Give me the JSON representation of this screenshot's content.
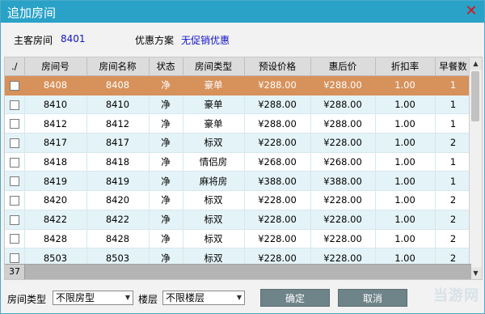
{
  "window": {
    "title": "追加房间"
  },
  "info": {
    "main_room_label": "主客房间",
    "main_room_value": "8401",
    "promo_label": "优惠方案",
    "promo_value": "无促销优惠"
  },
  "table": {
    "columns": [
      "./",
      "房间号",
      "房间名称",
      "状态",
      "房间类型",
      "预设价格",
      "惠后价",
      "折扣率",
      "早餐数"
    ],
    "rows": [
      {
        "room": "8408",
        "name": "8408",
        "status": "净",
        "type": "豪单",
        "price": "¥288.00",
        "after": "¥288.00",
        "rate": "1.00",
        "breakfast": "1",
        "selected": true
      },
      {
        "room": "8410",
        "name": "8410",
        "status": "净",
        "type": "豪单",
        "price": "¥288.00",
        "after": "¥288.00",
        "rate": "1.00",
        "breakfast": "1"
      },
      {
        "room": "8412",
        "name": "8412",
        "status": "净",
        "type": "豪单",
        "price": "¥288.00",
        "after": "¥288.00",
        "rate": "1.00",
        "breakfast": "1"
      },
      {
        "room": "8417",
        "name": "8417",
        "status": "净",
        "type": "标双",
        "price": "¥228.00",
        "after": "¥228.00",
        "rate": "1.00",
        "breakfast": "2"
      },
      {
        "room": "8418",
        "name": "8418",
        "status": "净",
        "type": "情侣房",
        "price": "¥268.00",
        "after": "¥268.00",
        "rate": "1.00",
        "breakfast": "1"
      },
      {
        "room": "8419",
        "name": "8419",
        "status": "净",
        "type": "麻将房",
        "price": "¥388.00",
        "after": "¥388.00",
        "rate": "1.00",
        "breakfast": "1"
      },
      {
        "room": "8420",
        "name": "8420",
        "status": "净",
        "type": "标双",
        "price": "¥228.00",
        "after": "¥228.00",
        "rate": "1.00",
        "breakfast": "2"
      },
      {
        "room": "8422",
        "name": "8422",
        "status": "净",
        "type": "标双",
        "price": "¥228.00",
        "after": "¥228.00",
        "rate": "1.00",
        "breakfast": "2"
      },
      {
        "room": "8428",
        "name": "8428",
        "status": "净",
        "type": "标双",
        "price": "¥228.00",
        "after": "¥228.00",
        "rate": "1.00",
        "breakfast": "2"
      },
      {
        "room": "8503",
        "name": "8503",
        "status": "净",
        "type": "标双",
        "price": "¥228.00",
        "after": "¥228.00",
        "rate": "1.00",
        "breakfast": "2"
      }
    ],
    "count": "37"
  },
  "filters": {
    "room_type_label": "房间类型",
    "room_type_value": "不限房型",
    "floor_label": "楼层",
    "floor_value": "不限楼层"
  },
  "buttons": {
    "ok": "确定",
    "cancel": "取消"
  },
  "watermark": "当游网",
  "colors": {
    "titlebar": "#2aa2c8",
    "selected_row": "#d7915b",
    "alt_row": "#e4f3f7",
    "link_blue": "#1414c8",
    "close_red": "#e01010"
  }
}
